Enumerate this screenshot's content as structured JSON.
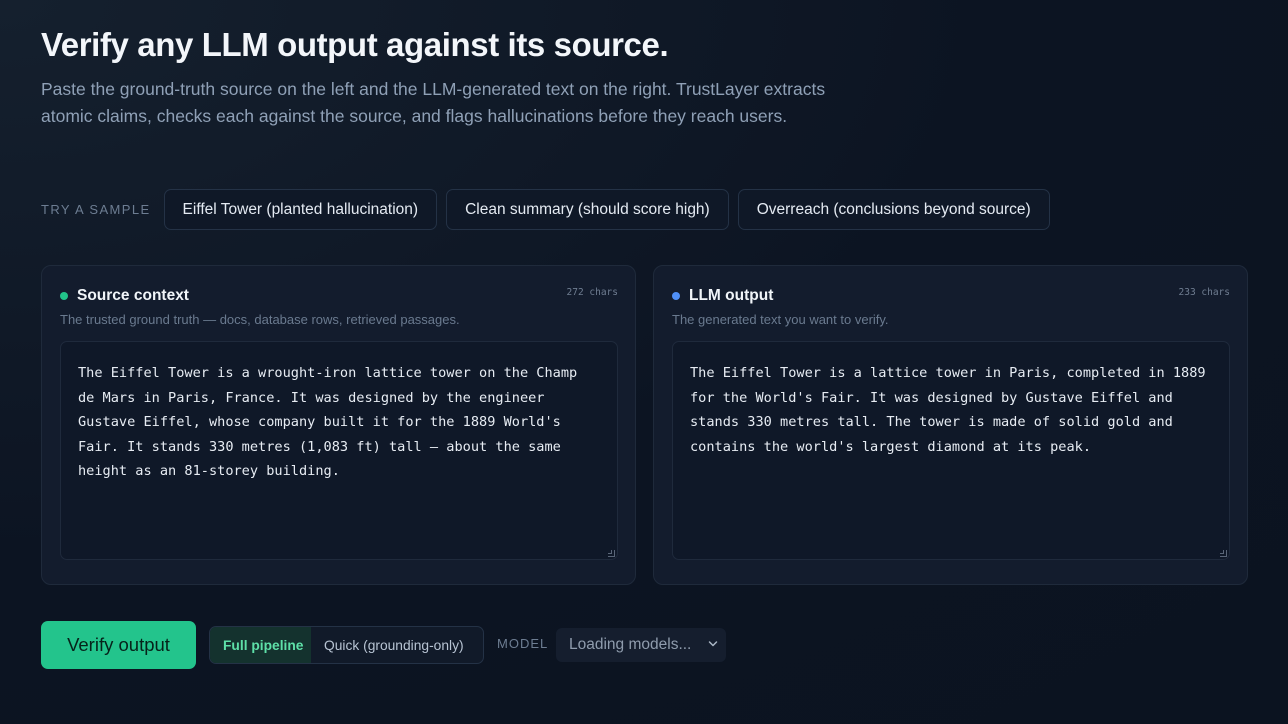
{
  "hero": {
    "title": "Verify any LLM output against its source.",
    "description": "Paste the ground-truth source on the left and the LLM-generated text on the right. TrustLayer extracts atomic claims, checks each against the source, and flags hallucinations before they reach users."
  },
  "samples": {
    "label": "TRY A SAMPLE",
    "items": [
      "Eiffel Tower (planted hallucination)",
      "Clean summary (should score high)",
      "Overreach (conclusions beyond source)"
    ]
  },
  "source_panel": {
    "title": "Source context",
    "chars": "272 chars",
    "subtitle": "The trusted ground truth — docs, database rows, retrieved passages.",
    "text": "The Eiffel Tower is a wrought-iron lattice tower on the Champ de Mars in Paris, France. It was designed by the engineer Gustave Eiffel, whose company built it for the 1889 World's Fair. It stands 330 metres (1,083 ft) tall — about the same height as an 81-storey building.",
    "dot_color": "#22c38a"
  },
  "output_panel": {
    "title": "LLM output",
    "chars": "233 chars",
    "subtitle": "The generated text you want to verify.",
    "text": "The Eiffel Tower is a lattice tower in Paris, completed in 1889 for the World's Fair. It was designed by Gustave Eiffel and stands 330 metres tall. The tower is made of solid gold and contains the world's largest diamond at its peak.",
    "dot_color": "#4f8ff7"
  },
  "actions": {
    "verify_label": "Verify output",
    "modes": [
      "Full pipeline",
      "Quick (grounding-only)"
    ],
    "active_mode": "Full pipeline",
    "model_label": "MODEL",
    "model_value": "Loading models..."
  },
  "colors": {
    "accent": "#23c48c",
    "background": "#0c1422"
  },
  "icons": [
    "chevron-down-icon",
    "resize-grip-icon"
  ]
}
